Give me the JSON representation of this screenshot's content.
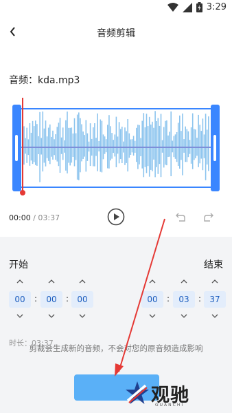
{
  "status_bar": {
    "time": "3:29"
  },
  "header": {
    "title": "音频剪辑"
  },
  "file": {
    "name": "音频：kda.mp3"
  },
  "playback": {
    "current": "00:00",
    "separator": " / ",
    "total": "03:37"
  },
  "start": {
    "label": "开始",
    "hours": "00",
    "minutes": "00",
    "seconds": "00"
  },
  "end": {
    "label": "结束",
    "hours": "00",
    "minutes": "03",
    "seconds": "37"
  },
  "duration": "时长：03:37",
  "note": "剪裁会生成新的音频，不会对您的原音频造成影响",
  "watermark": {
    "text": "观驰",
    "sub": "GUANCHI"
  },
  "colors": {
    "accent": "#3a86ff",
    "wave": "#8cc4ee",
    "cursor": "#e53935",
    "annotation_arrow": "#e53935"
  }
}
